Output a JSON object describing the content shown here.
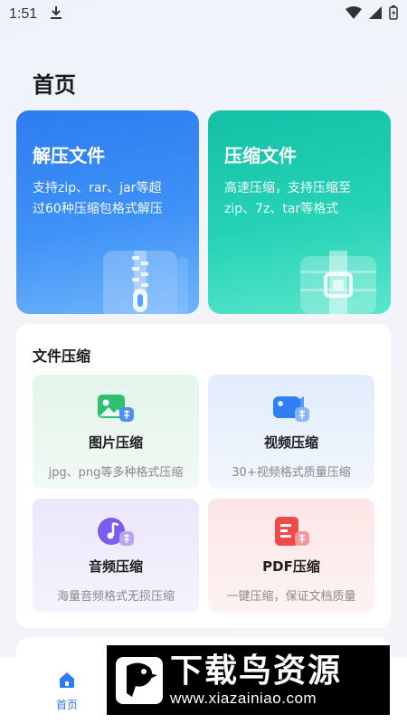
{
  "status_bar": {
    "time": "1:51"
  },
  "page": {
    "title": "首页"
  },
  "hero": {
    "unzip": {
      "title": "解压文件",
      "desc_line1": "支持zip、rar、jar等超",
      "desc_line2": "过60种压缩包格式解压"
    },
    "zip": {
      "title": "压缩文件",
      "desc_line1": "高速压缩，支持压缩至",
      "desc_line2": "zip、7z、tar等格式"
    }
  },
  "file_compress": {
    "title": "文件压缩",
    "tiles": [
      {
        "title": "图片压缩",
        "desc": "jpg、png等多种格式压缩"
      },
      {
        "title": "视频压缩",
        "desc": "30+视频格式质量压缩"
      },
      {
        "title": "音频压缩",
        "desc": "海量音频格式无损压缩"
      },
      {
        "title": "PDF压缩",
        "desc": "一键压缩，保证文档质量"
      }
    ]
  },
  "bottom_nav": {
    "home_label": "首页"
  },
  "watermark": {
    "title": "下载鸟资源",
    "url": "www.xiazainiao.com"
  },
  "colors": {
    "accent": "#2d7cf0",
    "teal": "#14c0a6"
  }
}
